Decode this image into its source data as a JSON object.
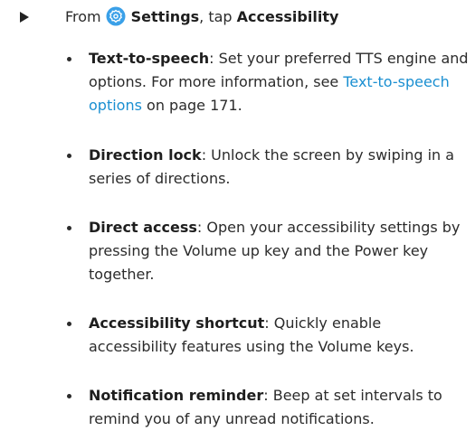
{
  "step": {
    "prefix": "From",
    "icon": "settings-gear-icon",
    "icon_color": "#3aa0e8",
    "settings_label": "Settings",
    "middle": ", tap ",
    "accessibility_label": "Accessibility"
  },
  "bullets": [
    {
      "term": "Text-to-speech",
      "text_before_link": ": Set your preferred TTS engine and options. For more information, see ",
      "link": "Text-to-speech options",
      "text_after_link": " on page 171."
    },
    {
      "term": "Direction lock",
      "text": ": Unlock the screen by swiping in a series of directions."
    },
    {
      "term": "Direct access",
      "text": ": Open your accessibility settings by pressing the Volume up key and the Power key together."
    },
    {
      "term": "Accessibility shortcut",
      "text": ": Quickly enable accessibility features using the Volume keys."
    },
    {
      "term": "Notification reminder",
      "text": ": Beep at set intervals to remind you of any unread notifications."
    }
  ],
  "colors": {
    "link": "#1a8fd1",
    "text": "#2b2b2b"
  }
}
